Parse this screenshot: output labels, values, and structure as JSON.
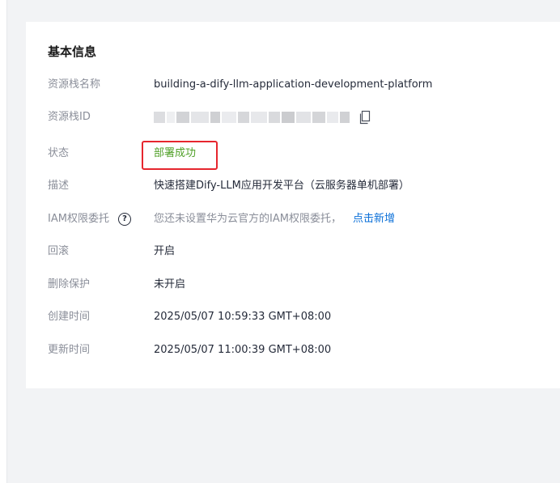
{
  "card": {
    "title": "基本信息"
  },
  "fields": {
    "stack_name": {
      "label": "资源栈名称",
      "value": "building-a-dify-llm-application-development-platform"
    },
    "stack_id": {
      "label": "资源栈ID"
    },
    "status": {
      "label": "状态",
      "value": "部署成功"
    },
    "description": {
      "label": "描述",
      "value": "快速搭建Dify-LLM应用开发平台（云服务器单机部署）"
    },
    "iam": {
      "label": "IAM权限委托",
      "help_icon": "question-circle-icon",
      "hint": "您还未设置华为云官方的IAM权限委托，",
      "link": "点击新增"
    },
    "rollback": {
      "label": "回滚",
      "value": "开启"
    },
    "deletion_protection": {
      "label": "删除保护",
      "value": "未开启"
    },
    "created_at": {
      "label": "创建时间",
      "value": "2025/05/07 10:59:33 GMT+08:00"
    },
    "updated_at": {
      "label": "更新时间",
      "value": "2025/05/07 11:00:39 GMT+08:00"
    }
  },
  "colors": {
    "status_success": "#50a028",
    "highlight_box": "#e6262e",
    "link": "#0a6fd8",
    "label": "#8a8e99",
    "value": "#252b3a"
  }
}
